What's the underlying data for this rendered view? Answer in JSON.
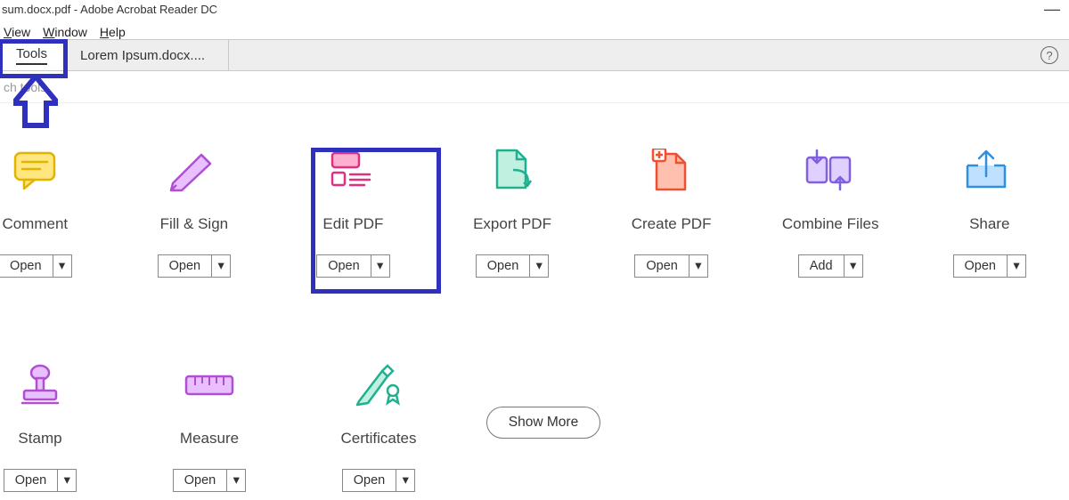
{
  "window": {
    "title": "sum.docx.pdf - Adobe Acrobat Reader DC"
  },
  "menu": {
    "view": "View",
    "window": "Window",
    "help": "Help"
  },
  "tabs": {
    "tools": "Tools",
    "doc": "Lorem Ipsum.docx...."
  },
  "search": {
    "placeholder": "ch tools"
  },
  "help_glyph": "?",
  "buttons": {
    "open": "Open",
    "add": "Add",
    "show_more": "Show More"
  },
  "tools": {
    "comment": {
      "label": "Comment",
      "button": "Open"
    },
    "fillsign": {
      "label": "Fill & Sign",
      "button": "Open"
    },
    "editpdf": {
      "label": "Edit PDF",
      "button": "Open"
    },
    "export": {
      "label": "Export PDF",
      "button": "Open"
    },
    "create": {
      "label": "Create PDF",
      "button": "Open"
    },
    "combine": {
      "label": "Combine Files",
      "button": "Add"
    },
    "share": {
      "label": "Share",
      "button": "Open"
    },
    "stamp": {
      "label": "Stamp",
      "button": "Open"
    },
    "measure": {
      "label": "Measure",
      "button": "Open"
    },
    "cert": {
      "label": "Certificates",
      "button": "Open"
    }
  }
}
